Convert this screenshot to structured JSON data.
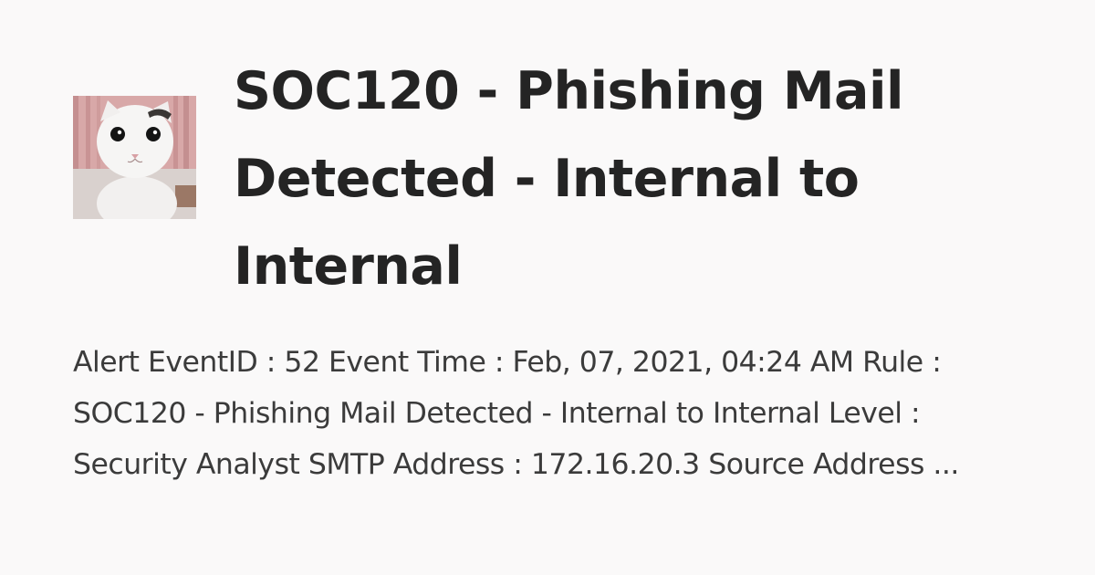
{
  "post": {
    "title": "SOC120 - Phishing Mail Detected - Internal to Internal",
    "excerpt": "Alert EventID : 52 Event Time : Feb, 07, 2021, 04:24 AM Rule : SOC120 - Phishing Mail Detected - Internal to Internal Level : Security Analyst SMTP Address : 172.16.20.3 Source Address ..."
  },
  "colors": {
    "background": "#faf9f9",
    "title_text": "#242424",
    "body_text": "#3b3b3b"
  },
  "icons": {
    "author_avatar": "cat-photo-avatar"
  }
}
